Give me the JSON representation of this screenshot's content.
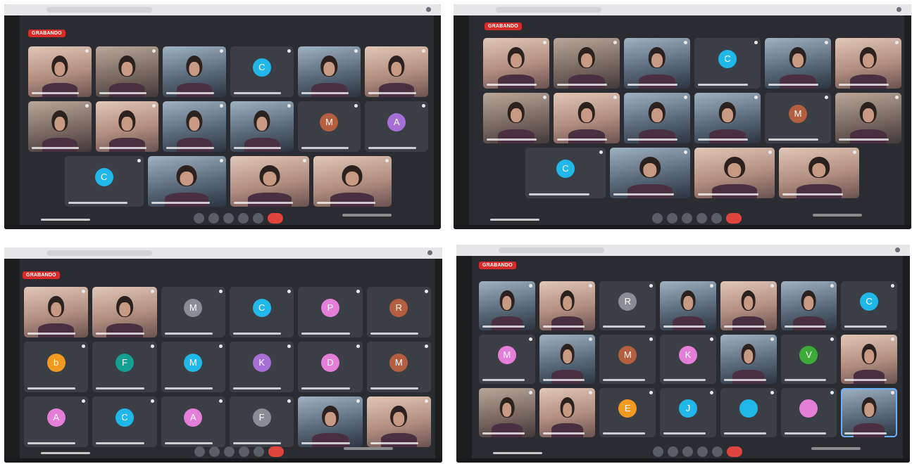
{
  "photos": [
    {
      "recording_label": "GRABANDO"
    },
    {
      "recording_label": "GRABANDO"
    },
    {
      "recording_label": "GRABANDO"
    },
    {
      "recording_label": "GRABANDO"
    }
  ],
  "avatar_colors": {
    "cyan": "#20b8e8",
    "orange": "#f19a1f",
    "teal": "#139f91",
    "purple": "#a56fd6",
    "pink": "#e57ed9",
    "brown": "#b46040",
    "green": "#3cab3a",
    "grey": "#8b8c95"
  },
  "grids": [
    {
      "id": "p1",
      "tiles": [
        {
          "kind": "video",
          "tone": "warm"
        },
        {
          "kind": "video"
        },
        {
          "kind": "video",
          "tone": "cool"
        },
        {
          "kind": "avatar",
          "letter": "C",
          "color": "cyan"
        },
        {
          "kind": "video",
          "tone": "cool"
        },
        {
          "kind": "video",
          "tone": "warm"
        },
        {
          "kind": "video"
        },
        {
          "kind": "video",
          "tone": "warm"
        },
        {
          "kind": "video",
          "tone": "cool"
        },
        {
          "kind": "video",
          "tone": "cool"
        },
        {
          "kind": "avatar",
          "letter": "M",
          "color": "brown"
        },
        {
          "kind": "avatar",
          "letter": "A",
          "color": "purple"
        },
        {
          "kind": "avatar",
          "letter": "C",
          "color": "cyan"
        },
        {
          "kind": "video",
          "tone": "cool"
        },
        {
          "kind": "video",
          "tone": "warm"
        },
        {
          "kind": "video",
          "tone": "warm"
        }
      ]
    },
    {
      "id": "p2",
      "tiles": [
        {
          "kind": "video",
          "tone": "warm"
        },
        {
          "kind": "video"
        },
        {
          "kind": "video",
          "tone": "cool"
        },
        {
          "kind": "avatar",
          "letter": "C",
          "color": "cyan"
        },
        {
          "kind": "video",
          "tone": "cool"
        },
        {
          "kind": "video",
          "tone": "warm"
        },
        {
          "kind": "video"
        },
        {
          "kind": "video",
          "tone": "warm"
        },
        {
          "kind": "video",
          "tone": "cool"
        },
        {
          "kind": "video",
          "tone": "cool"
        },
        {
          "kind": "avatar",
          "letter": "M",
          "color": "brown"
        },
        {
          "kind": "video"
        },
        {
          "kind": "avatar",
          "letter": "C",
          "color": "cyan"
        },
        {
          "kind": "video",
          "tone": "cool"
        },
        {
          "kind": "video",
          "tone": "warm"
        },
        {
          "kind": "video",
          "tone": "warm"
        }
      ]
    },
    {
      "id": "p3",
      "tiles": [
        {
          "kind": "video",
          "tone": "warm"
        },
        {
          "kind": "video",
          "tone": "warm"
        },
        {
          "kind": "avatar",
          "letter": "M",
          "color": "grey"
        },
        {
          "kind": "avatar",
          "letter": "C",
          "color": "cyan"
        },
        {
          "kind": "avatar",
          "letter": "P",
          "color": "pink"
        },
        {
          "kind": "avatar",
          "letter": "R",
          "color": "brown"
        },
        {
          "kind": "avatar",
          "letter": "b",
          "color": "orange"
        },
        {
          "kind": "avatar",
          "letter": "F",
          "color": "teal"
        },
        {
          "kind": "avatar",
          "letter": "M",
          "color": "cyan"
        },
        {
          "kind": "avatar",
          "letter": "K",
          "color": "purple"
        },
        {
          "kind": "avatar",
          "letter": "D",
          "color": "pink"
        },
        {
          "kind": "avatar",
          "letter": "M",
          "color": "brown"
        },
        {
          "kind": "avatar",
          "letter": "A",
          "color": "pink"
        },
        {
          "kind": "avatar",
          "letter": "C",
          "color": "cyan"
        },
        {
          "kind": "avatar",
          "letter": "A",
          "color": "pink"
        },
        {
          "kind": "avatar",
          "letter": "F",
          "color": "grey"
        },
        {
          "kind": "video",
          "tone": "cool"
        },
        {
          "kind": "video",
          "tone": "warm"
        }
      ]
    },
    {
      "id": "p4",
      "tiles": [
        {
          "kind": "video",
          "tone": "cool"
        },
        {
          "kind": "video",
          "tone": "warm"
        },
        {
          "kind": "avatar",
          "letter": "R",
          "color": "grey"
        },
        {
          "kind": "video",
          "tone": "cool"
        },
        {
          "kind": "video",
          "tone": "warm"
        },
        {
          "kind": "video",
          "tone": "cool"
        },
        {
          "kind": "avatar",
          "letter": "C",
          "color": "cyan"
        },
        {
          "kind": "avatar",
          "letter": "M",
          "color": "pink"
        },
        {
          "kind": "video",
          "tone": "cool"
        },
        {
          "kind": "avatar",
          "letter": "M",
          "color": "brown"
        },
        {
          "kind": "avatar",
          "letter": "K",
          "color": "pink"
        },
        {
          "kind": "video",
          "tone": "cool"
        },
        {
          "kind": "avatar",
          "letter": "V",
          "color": "green"
        },
        {
          "kind": "video",
          "tone": "warm"
        },
        {
          "kind": "video"
        },
        {
          "kind": "video",
          "tone": "warm"
        },
        {
          "kind": "avatar",
          "letter": "E",
          "color": "orange"
        },
        {
          "kind": "avatar",
          "letter": "J",
          "color": "cyan"
        },
        {
          "kind": "avatar",
          "letter": "",
          "color": "cyan"
        },
        {
          "kind": "avatar",
          "letter": "",
          "color": "pink"
        },
        {
          "kind": "video",
          "tone": "cool",
          "speaking": true
        }
      ]
    }
  ]
}
